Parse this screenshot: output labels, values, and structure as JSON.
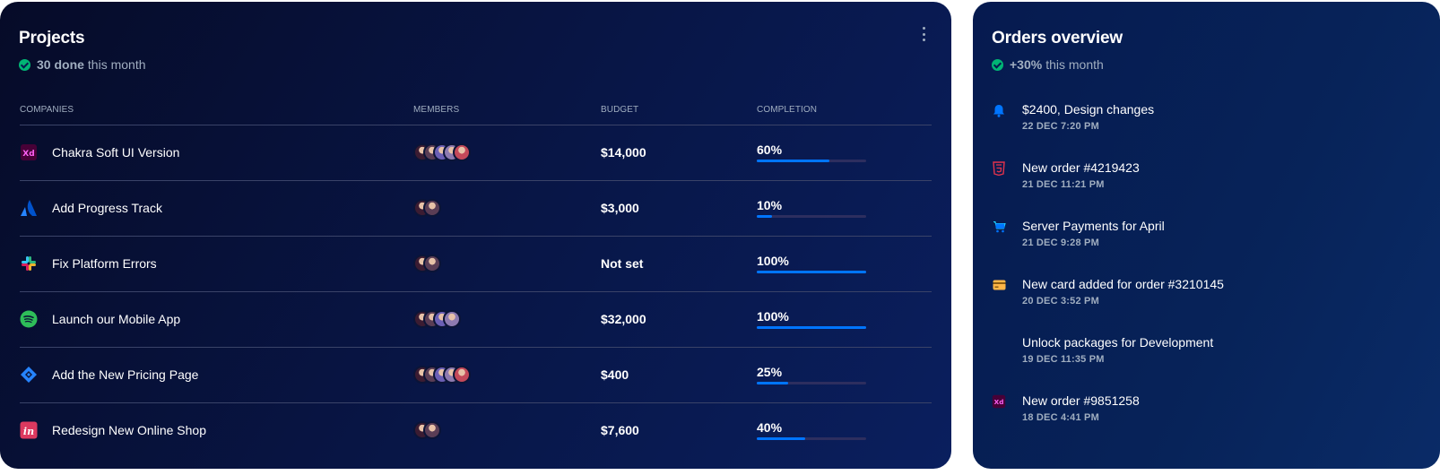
{
  "projects": {
    "title": "Projects",
    "done_count": "30 done",
    "done_suffix": "this month",
    "columns": [
      "COMPANIES",
      "MEMBERS",
      "BUDGET",
      "COMPLETION"
    ],
    "rows": [
      {
        "logo": "adobe-xd-icon",
        "name": "Chakra Soft UI Version",
        "members": 5,
        "budget": "$14,000",
        "completion": "60%",
        "progress": 0.66
      },
      {
        "logo": "atlassian-icon",
        "name": "Add Progress Track",
        "members": 2,
        "budget": "$3,000",
        "completion": "10%",
        "progress": 0.14
      },
      {
        "logo": "slack-icon",
        "name": "Fix Platform Errors",
        "members": 2,
        "budget": "Not set",
        "completion": "100%",
        "progress": 1.0
      },
      {
        "logo": "spotify-icon",
        "name": "Launch our Mobile App",
        "members": 4,
        "budget": "$32,000",
        "completion": "100%",
        "progress": 1.0
      },
      {
        "logo": "jira-icon",
        "name": "Add the New Pricing Page",
        "members": 5,
        "budget": "$400",
        "completion": "25%",
        "progress": 0.29
      },
      {
        "logo": "invision-icon",
        "name": "Redesign New Online Shop",
        "members": 2,
        "budget": "$7,600",
        "completion": "40%",
        "progress": 0.44
      }
    ]
  },
  "orders": {
    "title": "Orders overview",
    "growth": "+30%",
    "growth_suffix": "this month",
    "items": [
      {
        "icon": "bell-icon",
        "title": "$2400, Design changes",
        "date": "22 DEC 7:20 PM"
      },
      {
        "icon": "html5-icon",
        "title": "New order #4219423",
        "date": "21 DEC 11:21 PM"
      },
      {
        "icon": "cart-icon",
        "title": "Server Payments for April",
        "date": "21 DEC 9:28 PM"
      },
      {
        "icon": "credit-card-icon",
        "title": "New card added for order #3210145",
        "date": "20 DEC 3:52 PM"
      },
      {
        "icon": "",
        "title": "Unlock packages for Development",
        "date": "19 DEC 11:35 PM"
      },
      {
        "icon": "adobe-xd-icon",
        "title": "New order #9851258",
        "date": "18 DEC 4:41 PM"
      }
    ]
  },
  "colors": {
    "accent": "#0075ff",
    "success": "#01b574",
    "muted": "#a0aec0"
  }
}
